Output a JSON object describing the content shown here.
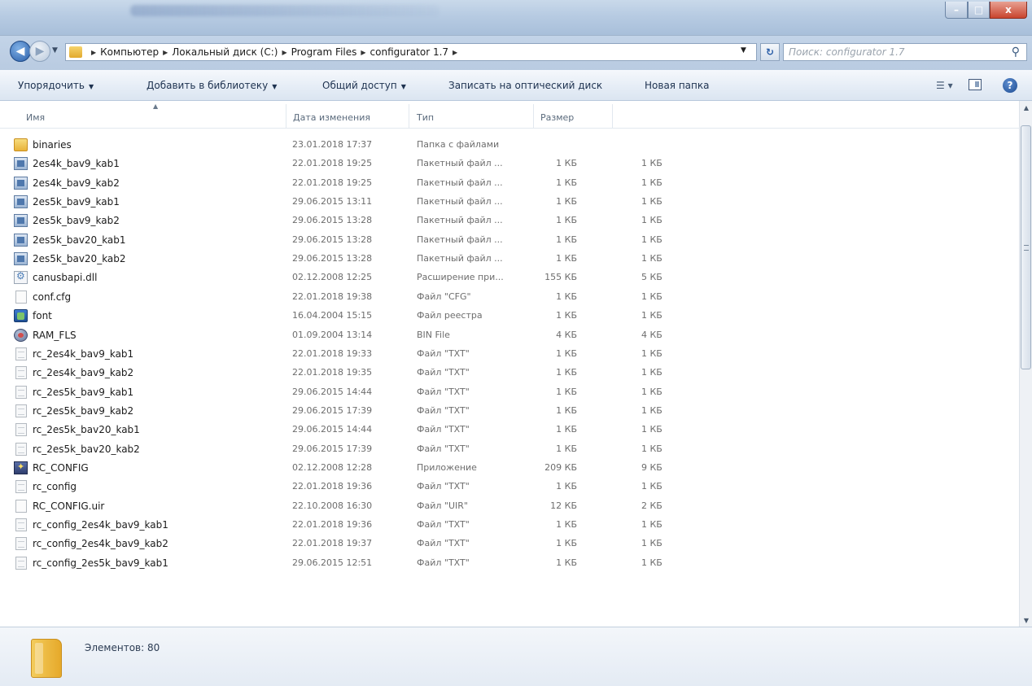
{
  "window": {
    "controls": {
      "minimize": "–",
      "maximize": "□",
      "close": "x"
    }
  },
  "address": {
    "crumbs": [
      "Компьютер",
      "Локальный диск (C:)",
      "Program Files",
      "configurator 1.7"
    ],
    "search_placeholder": "Поиск: configurator 1.7"
  },
  "commands": {
    "organize": "Упорядочить",
    "add_to_library": "Добавить в библиотеку",
    "share": "Общий доступ",
    "burn": "Записать на оптический диск",
    "new_folder": "Новая папка"
  },
  "columns": {
    "name": "Имя",
    "date": "Дата изменения",
    "type": "Тип",
    "size": "Размер"
  },
  "files": [
    {
      "name": "binaries",
      "date": "23.01.2018 17:37",
      "type": "Папка с файлами",
      "size": "",
      "extra": "",
      "icon": "folder"
    },
    {
      "name": "2es4k_bav9_kab1",
      "date": "22.01.2018 19:25",
      "type": "Пакетный файл ...",
      "size": "1 КБ",
      "extra": "1 КБ",
      "icon": "batch"
    },
    {
      "name": "2es4k_bav9_kab2",
      "date": "22.01.2018 19:25",
      "type": "Пакетный файл ...",
      "size": "1 КБ",
      "extra": "1 КБ",
      "icon": "batch"
    },
    {
      "name": "2es5k_bav9_kab1",
      "date": "29.06.2015 13:11",
      "type": "Пакетный файл ...",
      "size": "1 КБ",
      "extra": "1 КБ",
      "icon": "batch"
    },
    {
      "name": "2es5k_bav9_kab2",
      "date": "29.06.2015 13:28",
      "type": "Пакетный файл ...",
      "size": "1 КБ",
      "extra": "1 КБ",
      "icon": "batch"
    },
    {
      "name": "2es5k_bav20_kab1",
      "date": "29.06.2015 13:28",
      "type": "Пакетный файл ...",
      "size": "1 КБ",
      "extra": "1 КБ",
      "icon": "batch"
    },
    {
      "name": "2es5k_bav20_kab2",
      "date": "29.06.2015 13:28",
      "type": "Пакетный файл ...",
      "size": "1 КБ",
      "extra": "1 КБ",
      "icon": "batch"
    },
    {
      "name": "canusbapi.dll",
      "date": "02.12.2008 12:25",
      "type": "Расширение при...",
      "size": "155 КБ",
      "extra": "5 КБ",
      "icon": "dll"
    },
    {
      "name": "conf.cfg",
      "date": "22.01.2018 19:38",
      "type": "Файл \"CFG\"",
      "size": "1 КБ",
      "extra": "1 КБ",
      "icon": "doc"
    },
    {
      "name": "font",
      "date": "16.04.2004 15:15",
      "type": "Файл реестра",
      "size": "1 КБ",
      "extra": "1 КБ",
      "icon": "reg"
    },
    {
      "name": "RAM_FLS",
      "date": "01.09.2004 13:14",
      "type": "BIN File",
      "size": "4 КБ",
      "extra": "4 КБ",
      "icon": "bin"
    },
    {
      "name": "rc_2es4k_bav9_kab1",
      "date": "22.01.2018 19:33",
      "type": "Файл \"TXT\"",
      "size": "1 КБ",
      "extra": "1 КБ",
      "icon": "txt"
    },
    {
      "name": "rc_2es4k_bav9_kab2",
      "date": "22.01.2018 19:35",
      "type": "Файл \"TXT\"",
      "size": "1 КБ",
      "extra": "1 КБ",
      "icon": "txt"
    },
    {
      "name": "rc_2es5k_bav9_kab1",
      "date": "29.06.2015 14:44",
      "type": "Файл \"TXT\"",
      "size": "1 КБ",
      "extra": "1 КБ",
      "icon": "txt"
    },
    {
      "name": "rc_2es5k_bav9_kab2",
      "date": "29.06.2015 17:39",
      "type": "Файл \"TXT\"",
      "size": "1 КБ",
      "extra": "1 КБ",
      "icon": "txt"
    },
    {
      "name": "rc_2es5k_bav20_kab1",
      "date": "29.06.2015 14:44",
      "type": "Файл \"TXT\"",
      "size": "1 КБ",
      "extra": "1 КБ",
      "icon": "txt"
    },
    {
      "name": "rc_2es5k_bav20_kab2",
      "date": "29.06.2015 17:39",
      "type": "Файл \"TXT\"",
      "size": "1 КБ",
      "extra": "1 КБ",
      "icon": "txt"
    },
    {
      "name": "RC_CONFIG",
      "date": "02.12.2008 12:28",
      "type": "Приложение",
      "size": "209 КБ",
      "extra": "9 КБ",
      "icon": "app"
    },
    {
      "name": "rc_config",
      "date": "22.01.2018 19:36",
      "type": "Файл \"TXT\"",
      "size": "1 КБ",
      "extra": "1 КБ",
      "icon": "txt"
    },
    {
      "name": "RC_CONFIG.uir",
      "date": "22.10.2008 16:30",
      "type": "Файл \"UIR\"",
      "size": "12 КБ",
      "extra": "2 КБ",
      "icon": "doc"
    },
    {
      "name": "rc_config_2es4k_bav9_kab1",
      "date": "22.01.2018 19:36",
      "type": "Файл \"TXT\"",
      "size": "1 КБ",
      "extra": "1 КБ",
      "icon": "txt"
    },
    {
      "name": "rc_config_2es4k_bav9_kab2",
      "date": "22.01.2018 19:37",
      "type": "Файл \"TXT\"",
      "size": "1 КБ",
      "extra": "1 КБ",
      "icon": "txt"
    },
    {
      "name": "rc_config_2es5k_bav9_kab1",
      "date": "29.06.2015 12:51",
      "type": "Файл \"TXT\"",
      "size": "1 КБ",
      "extra": "1 КБ",
      "icon": "txt"
    }
  ],
  "status": {
    "items": "Элементов: 80"
  }
}
